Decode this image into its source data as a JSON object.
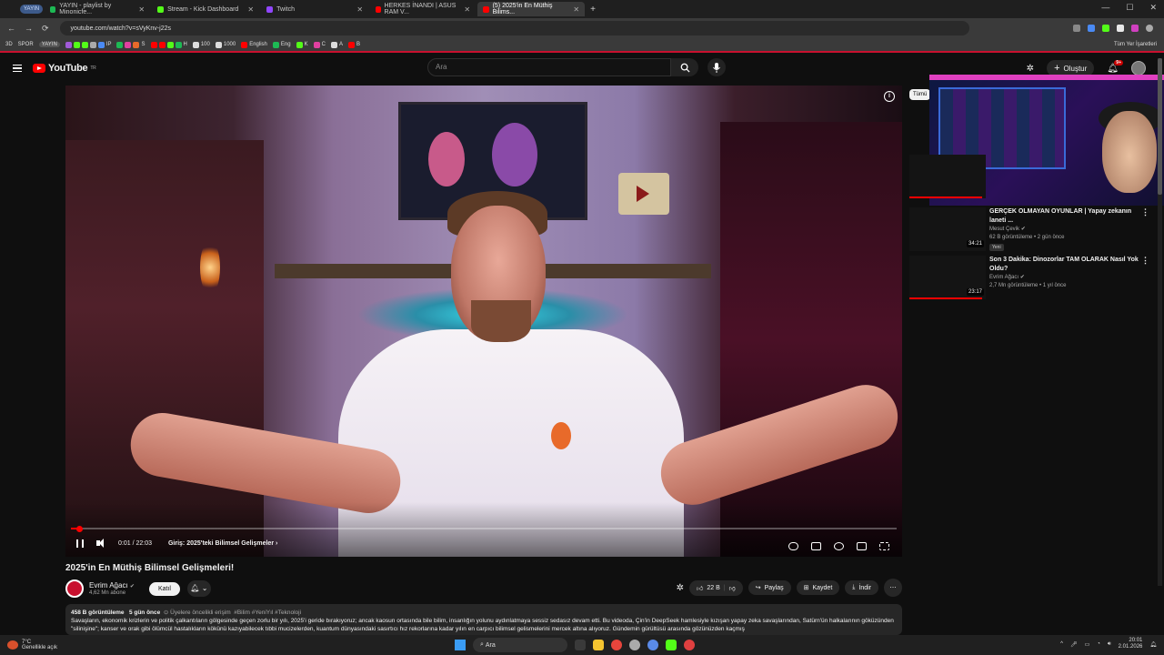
{
  "browser": {
    "tab_group": "YAYIN",
    "tabs": [
      {
        "label": "YAYIN - playlist by Minonicfe...",
        "color": "#1db954"
      },
      {
        "label": "Stream - Kick Dashboard",
        "color": "#53fc18"
      },
      {
        "label": "Twitch",
        "color": "#9146ff"
      },
      {
        "label": "HERKES İNANDI | ASUS RAM V...",
        "color": "#ff0000"
      },
      {
        "label": "(5) 2025'in En Müthiş Bilims...",
        "color": "#ff0000",
        "active": true
      }
    ],
    "url": "youtube.com/watch?v=sVyKnv-j22s",
    "bookmarks": [
      "3D",
      "SPOR",
      "YAYIN",
      "IP",
      "S",
      "H",
      "100",
      "1000",
      "English",
      "Eng",
      "K",
      "C",
      "A",
      "B"
    ],
    "all_bookmarks": "Tüm Yer İşaretleri"
  },
  "youtube": {
    "logo": "YouTube",
    "logo_region": "TR",
    "search_placeholder": "Ara",
    "create_label": "Oluştur",
    "notif_count": "9+"
  },
  "player": {
    "current_time": "0:01",
    "duration": "22:03",
    "time_display": "0:01 / 22:03",
    "chapter": "Giriş: 2025'teki Bilimsel Gelişmeler",
    "progress_fraction": 0.01
  },
  "video": {
    "title": "2025'in En Müthiş Bilimsel Gelişmeleri!",
    "channel": "Evrim Ağacı",
    "subscribers": "4,62 Mn abone",
    "join_label": "Katıl",
    "likes": "22 B",
    "share_label": "Paylaş",
    "save_label": "Kaydet",
    "download_label": "İndir",
    "views": "458 B görüntüleme",
    "age": "5 gün önce",
    "members_only": "Üyelere öncelikli erişim",
    "tags": "#Bilim #YeniYıl #Teknoloji",
    "description": "Savaşların, ekonomik krizlerin ve politik çalkantıların gölgesinde geçen zorlu bir yılı, 2025'i geride bırakıyoruz; ancak kaosun ortasında bile bilim, insanlığın yolunu aydınlatmaya sessiz sedasız devam etti. Bu videoda, Çin'in DeepSeek hamlesiyle kızışan yapay zeka savaşlarından, Satürn'ün halkalarının göküzünden \"silinişine\"; kanser ve orak gibi ölümcül hastalıkların kökünü kazıyabilecek tıbbi mucizelerden, kuantum dünyasındaki sasırtıcı hız rekorlarına kadar yılın en carpıcı bilimsel gelismelerini mercek altına alıyoruz. Gündemin gürültüsü arasında gözünüzden kaçmış"
  },
  "filter_chip": "Tümü",
  "recommendations": [
    {
      "title": "GERÇEK OLMAYAN OYUNLAR | Yapay zekanın laneti ...",
      "channel": "Mesut Çevik",
      "meta": "62 B görüntüleme • 2 gün önce",
      "badge": "Yeni",
      "duration": "34:21",
      "watched": 0
    },
    {
      "title": "Son 3 Dakika: Dinozorlar TAM OLARAK Nasıl Yok Oldu?",
      "channel": "Evrim Ağacı",
      "meta": "2,7 Mn görüntüleme • 1 yıl önce",
      "badge": "",
      "duration": "23:17",
      "watched": 0.95
    },
    {
      "title": "",
      "channel": "",
      "meta": "",
      "badge": "",
      "duration": "",
      "watched": 0.95
    }
  ],
  "taskbar": {
    "temp": "7°C",
    "weather": "Genellikle açık",
    "search": "Ara",
    "time": "20:01",
    "date": "2.01.2026"
  },
  "icons": [
    "search-icon",
    "mic-icon",
    "bell-icon",
    "like-icon",
    "dislike-icon",
    "share-icon",
    "save-icon",
    "download-icon",
    "more-icon",
    "info-icon",
    "pause-icon",
    "volume-icon",
    "settings-icon",
    "fullscreen-icon"
  ]
}
